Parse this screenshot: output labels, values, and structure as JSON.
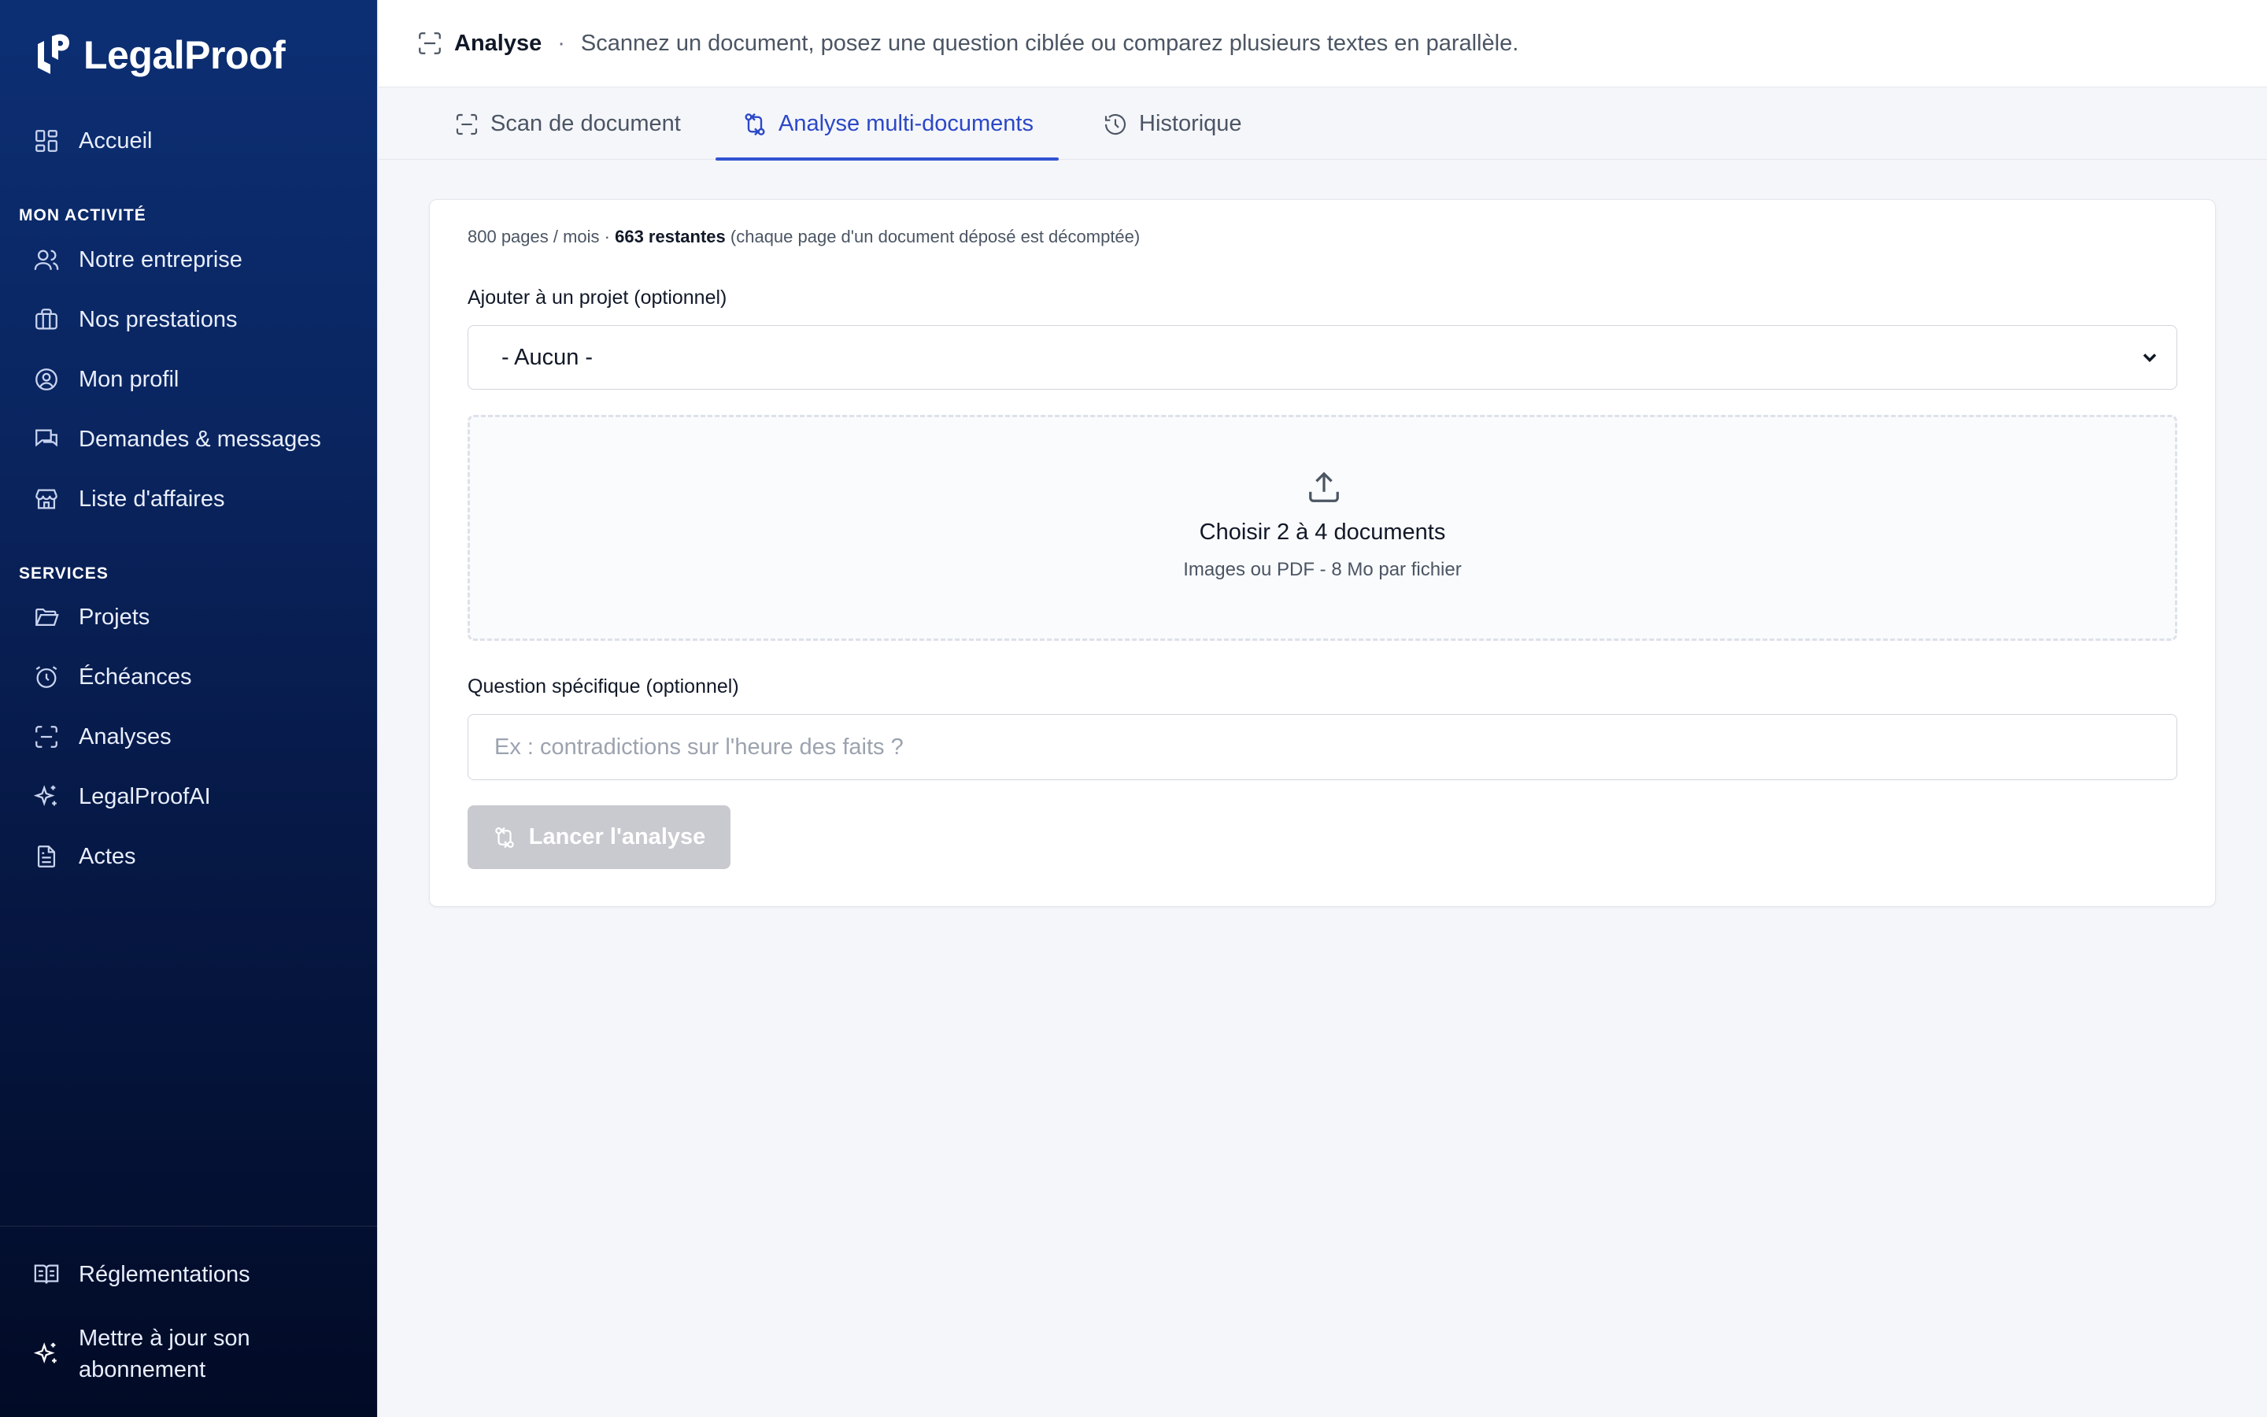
{
  "brand": {
    "name": "LegalProof"
  },
  "sidebar": {
    "home": "Accueil",
    "section_activity": "MON ACTIVITÉ",
    "activity_items": [
      "Notre entreprise",
      "Nos prestations",
      "Mon profil",
      "Demandes & messages",
      "Liste d'affaires"
    ],
    "section_services": "SERVICES",
    "service_items": [
      "Projets",
      "Échéances",
      "Analyses",
      "LegalProofAI",
      "Actes"
    ],
    "bottom_regulations": "Réglementations",
    "bottom_upgrade_line1": "Mettre à jour son",
    "bottom_upgrade_line2": "abonnement"
  },
  "header": {
    "title": "Analyse",
    "separator": "·",
    "subtitle": "Scannez un document, posez une question ciblée ou comparez plusieurs textes en parallèle."
  },
  "tabs": [
    {
      "label": "Scan de document",
      "active": false
    },
    {
      "label": "Analyse multi-documents",
      "active": true
    },
    {
      "label": "Historique",
      "active": false
    }
  ],
  "form": {
    "quota_prefix": "800 pages / mois ·",
    "quota_remaining": "663 restantes",
    "quota_suffix": "(chaque page d'un document déposé est décomptée)",
    "project_label": "Ajouter à un projet (optionnel)",
    "project_value": "- Aucun -",
    "dropzone_title": "Choisir 2 à 4 documents",
    "dropzone_subtitle": "Images ou PDF - 8 Mo par fichier",
    "question_label": "Question spécifique (optionnel)",
    "question_placeholder": "Ex : contradictions sur l'heure des faits ?",
    "question_value": "",
    "submit_label": "Lancer l'analyse"
  },
  "colors": {
    "sidebar_top": "#0c2f74",
    "sidebar_bottom": "#020b26",
    "accent": "#3353d1",
    "button_disabled": "#c8cad0"
  }
}
